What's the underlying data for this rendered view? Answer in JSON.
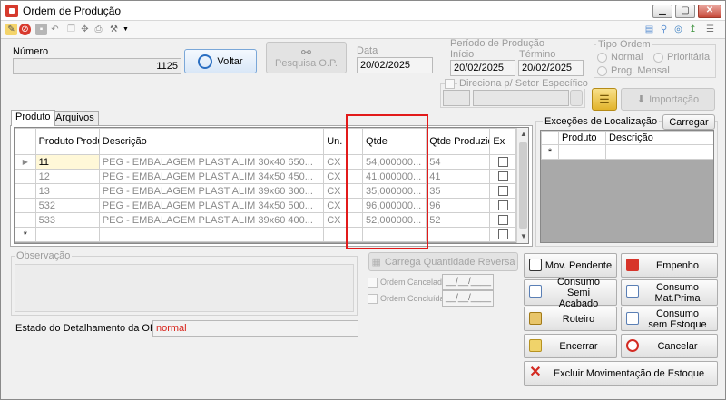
{
  "window": {
    "title": "Ordem de Produção"
  },
  "header": {
    "numero_label": "Número",
    "numero_value": "1125",
    "voltar_label": "Voltar",
    "pesquisa_label": "Pesquisa O.P.",
    "data_label": "Data",
    "data_value": "20/02/2025",
    "periodo_label": "Período de Produção",
    "inicio_label": "Início",
    "inicio_value": "20/02/2025",
    "termino_label": "Término",
    "termino_value": "20/02/2025",
    "tipo_ordem_label": "Tipo Ordem",
    "tipo_normal": "Normal",
    "tipo_prioritaria": "Prioritária",
    "tipo_prog_mensal": "Prog. Mensal",
    "direciona_label": "Direciona p/ Setor Específico",
    "importacao_label": "Importação"
  },
  "tabs": [
    {
      "label": "Produto"
    },
    {
      "label": "Arquivos"
    }
  ],
  "grid": {
    "columns": [
      "Produto Produção",
      "Descrição",
      "Un.",
      "Qtde",
      "Qtde Produzida",
      "Ex"
    ],
    "rows": [
      {
        "produto": "11",
        "descricao": "PEG - EMBALAGEM PLAST ALIM 30x40 650...",
        "un": "CX",
        "qtde": "54,000000...",
        "produzida": "54"
      },
      {
        "produto": "12",
        "descricao": "PEG - EMBALAGEM PLAST ALIM 34x50 450...",
        "un": "CX",
        "qtde": "41,000000...",
        "produzida": "41"
      },
      {
        "produto": "13",
        "descricao": "PEG - EMBALAGEM PLAST ALIM 39x60 300...",
        "un": "CX",
        "qtde": "35,000000...",
        "produzida": "35"
      },
      {
        "produto": "532",
        "descricao": "PEG - EMBALAGEM PLAST ALIM 34x50 500...",
        "un": "CX",
        "qtde": "96,000000...",
        "produzida": "96"
      },
      {
        "produto": "533",
        "descricao": "PEG - EMBALAGEM PLAST ALIM 39x60 400...",
        "un": "CX",
        "qtde": "52,000000...",
        "produzida": "52"
      }
    ],
    "new_row_marker": "*",
    "current_row_marker": "▶"
  },
  "excecoes": {
    "title": "Exceções de Localização",
    "carregar_label": "Carregar",
    "columns": [
      "Produto",
      "Descrição"
    ],
    "new_row_marker": "*"
  },
  "observacao": {
    "label": "Observação"
  },
  "carrega_label": "Carrega Quantidade Reversa",
  "ordem_cancelada_label": "Ordem Cancelada",
  "ordem_cancelada_value": "__/__/____",
  "ordem_concluida_label": "Ordem Concluída",
  "ordem_concluida_value": "__/__/____",
  "estado": {
    "label": "Estado do Detalhamento da OP:",
    "value": "normal"
  },
  "actions": {
    "mov_pendente": "Mov. Pendente",
    "empenho": "Empenho",
    "consumo_semi_1": "Consumo Semi",
    "consumo_semi_2": "Acabado",
    "consumo_mat_1": "Consumo",
    "consumo_mat_2": "Mat.Prima",
    "roteiro": "Roteiro",
    "consumo_sem_1": "Consumo",
    "consumo_sem_2": "sem Estoque",
    "encerrar": "Encerrar",
    "cancelar": "Cancelar",
    "excluir": "Excluir Movimentação de Estoque"
  },
  "colors": {
    "highlight_red": "#e21a1a",
    "estado_value": "#d8231a",
    "accent_blue": "#2b6fc2"
  }
}
